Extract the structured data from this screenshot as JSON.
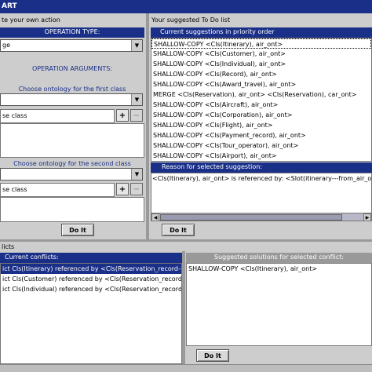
{
  "window": {
    "title": "ART"
  },
  "left_panel": {
    "title": "te your own action",
    "operation_type_header": "OPERATION TYPE:",
    "operation_type_value": "ge",
    "operation_args_header": "OPERATION ARGUMENTS:",
    "first_class_header": "Choose ontology for the first class",
    "first_class_value": "se class",
    "second_class_header": "Choose ontology for the second class",
    "second_class_value": "se class",
    "do_it_label": "Do It"
  },
  "todo_panel": {
    "title": "Your suggested To Do list",
    "suggestions_header": "Current suggestions in priority order",
    "suggestions": [
      "SHALLOW-COPY <Cls(Itinerary), air_ont>",
      "SHALLOW-COPY <Cls(Customer), air_ont>",
      "SHALLOW-COPY <Cls(Individual), air_ont>",
      "SHALLOW-COPY <Cls(Record), air_ont>",
      "SHALLOW-COPY <Cls(Award_travel), air_ont>",
      "MERGE <Cls(Reservation), air_ont> <Cls(Reservation), car_ont>",
      "SHALLOW-COPY <Cls(Aircraft), air_ont>",
      "SHALLOW-COPY <Cls(Corporation), air_ont>",
      "SHALLOW-COPY <Cls(Flight), air_ont>",
      "SHALLOW-COPY <Cls(Payment_record), air_ont>",
      "SHALLOW-COPY <Cls(Tour_operator), air_ont>",
      "SHALLOW-COPY <Cls(Airport), air_ont>"
    ],
    "reason_header": "Reason for selected suggestion:",
    "reason_text": "<Cls(Itinerary), air_ont> is referenced by: <Slot(itinerary---from_air_ont), air_",
    "do_it_label": "Do It"
  },
  "conflicts_panel": {
    "title": "licts",
    "current_header": "Current conflicts:",
    "conflicts": [
      "ict Cls(Itinerary) referenced by <Cls(Reservation_record---",
      "ict Cls(Customer) referenced by <Cls(Reservation_record",
      "ict Cls(Individual) referenced by <Cls(Reservation_record"
    ],
    "solutions_header": "Suggested solutions for selected conflict:",
    "solutions": [
      "SHALLOW-COPY <Cls(Itinerary), air_ont>"
    ],
    "do_it_label": "Do It"
  }
}
